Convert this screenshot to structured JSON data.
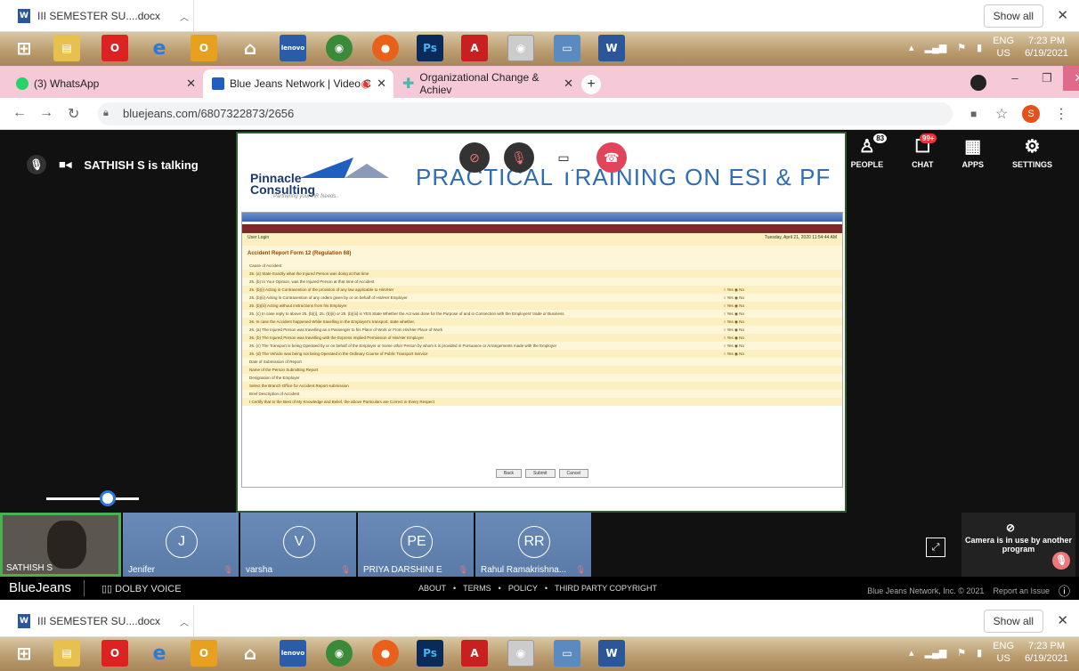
{
  "downloads": {
    "file_name": "III SEMESTER SU....docx",
    "show_all": "Show all"
  },
  "tray": {
    "lang": "ENG",
    "region": "US",
    "time": "7:23 PM",
    "date": "6/19/2021"
  },
  "tabs": [
    {
      "label": "(3) WhatsApp",
      "icon_color": "#25d366"
    },
    {
      "label": "Blue Jeans Network | Video C",
      "icon_color": "#1f5fbf"
    },
    {
      "label": "Organizational Change & Achiev",
      "icon_color": "#4db6ac"
    }
  ],
  "url": "bluejeans.com/6807322873/2656",
  "meeting": {
    "talking": "SATHISH S is talking",
    "slide_title": "PRACTICAL TRAINING ON ESI & PF",
    "logo_line1": "Pinnacle",
    "logo_line2": "Consulting",
    "logo_tagline": "Partnering your HR Needs..",
    "form_title": "Accident Report Form 12 (Regulation 68)",
    "user_login": "User Login",
    "form_date": "Tuesday, April 21, 2020 11:54:44 AM",
    "form_rows": [
      "Cause of Accident",
      "25. (a) State Exactly what the Injured Person was doing at that time",
      "25. (b) In Your Opinion, was the Injured Person at that time of Accident",
      "25. (b)(i) Acting in Contravention of the provision of any law applicable to Him/Her",
      "25. (b)(ii) Acting in Contravention of any orders given by or on behalf of His/Her Employer",
      "25. (b)(iii) Acting without instructions from his Employer",
      "25. (c) In case reply to above 25. (b)(i), 25. (b)(ii) or 25. (b)(iii) is YES State Whether the Act was done for the Purpose of and in Connection with the Employers' trade or Business",
      "26. In case the Accident happened While travelling in the Employer's transport, state whether,",
      "26. (a) The Injured Person was travelling as a Passenger to his Place of Work or From His/Her Place of Work",
      "26. (b) The Injured Person was travelling with the Express Implied Permission of His/Her Employer",
      "26. (c) The Transport is being Operated by or on behalf of the Employer or Some other Person by whom it is provided in Pursuance or Arrangements made with the Employer",
      "26. (d) The Vehicle was being not being Operated in the Ordinary Course of Public Transport Service",
      "Date of Submission of Report",
      "Name of the Person Submitting Report",
      "Designation of the Employer",
      "Select the Branch Office for Accident Report submission",
      "Brief Description of Accident",
      "I Certify that to the Best of My Knowledge and Belief, the above Particulars are Correct in Every Respect"
    ],
    "form_values": {
      "activity": "PERSON WAS HANDLING MA",
      "date": "21/04/2020",
      "name": "SATHISH",
      "designation": "PROPRIETOR",
      "branch": "SO - George Town",
      "description": "LOST HIS FINGER ON CARRYING GOODS"
    },
    "form_buttons": [
      "Back",
      "Submit",
      "Cancel"
    ],
    "people_count": "83",
    "chat_badge": "99+",
    "right_buttons": {
      "people": "PEOPLE",
      "chat": "CHAT",
      "apps": "APPS",
      "settings": "SETTINGS"
    }
  },
  "participants": [
    {
      "initials": "J",
      "name": "Jenifer"
    },
    {
      "initials": "V",
      "name": "varsha"
    },
    {
      "initials": "PE",
      "name": "PRIYA DARSHINI E"
    },
    {
      "initials": "RR",
      "name": "Rahul Ramakrishna..."
    }
  ],
  "self_name": "SATHISH S",
  "camera_note": "Camera is in use by another program",
  "footer": {
    "brand": "BlueJeans",
    "dolby": "DOLBY VOICE",
    "links": [
      "ABOUT",
      "TERMS",
      "POLICY",
      "THIRD PARTY COPYRIGHT"
    ],
    "copyright": "Blue Jeans Network, Inc. © 2021",
    "report": "Report an Issue"
  }
}
